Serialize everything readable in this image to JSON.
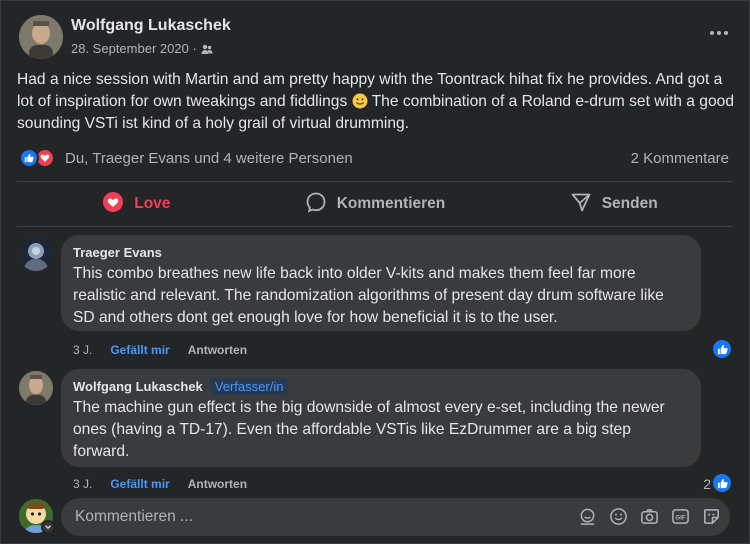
{
  "post": {
    "author": "Wolfgang Lukaschek",
    "date": "28. September 2020 ·",
    "text": "Had a nice session with Martin and am pretty happy with the Toontrack hihat fix he provides. And got a lot of inspiration for own tweakings and fiddlings",
    "text_after_emoji": " The combination of a Roland e-drum set with a good sounding VSTi ist kind of a holy grail of virtual drumming.",
    "reaction_summary": "Du, Traeger Evans und 4 weitere Personen",
    "comment_count": "2 Kommentare"
  },
  "actions": {
    "love": "Love",
    "comment": "Kommentieren",
    "send": "Senden"
  },
  "comments": [
    {
      "name": "Traeger Evans",
      "text": "This combo breathes new life back into older V-kits and makes them feel far more realistic and relevant. The randomization algorithms of present day drum software like SD and others dont get enough love for how beneficial it is to the user.",
      "age": "3 J.",
      "like_label": "Gefällt mir",
      "reply_label": "Antworten"
    },
    {
      "name": "Wolfgang Lukaschek",
      "badge": "Verfasser/in",
      "text": "The machine gun effect is the big downside of almost every e-set, including the newer ones (having a TD-17). Even the affordable VSTis like EzDrummer are a big step forward.",
      "age": "3 J.",
      "like_label": "Gefällt mir",
      "reply_label": "Antworten",
      "like_count": "2"
    }
  ],
  "compose": {
    "placeholder": "Kommentieren ..."
  },
  "colors": {
    "background": "#242526",
    "bubble": "#3a3b3c",
    "accent_blue": "#4599ff",
    "love_red": "#f33e58",
    "like_blue": "#1877f2"
  }
}
